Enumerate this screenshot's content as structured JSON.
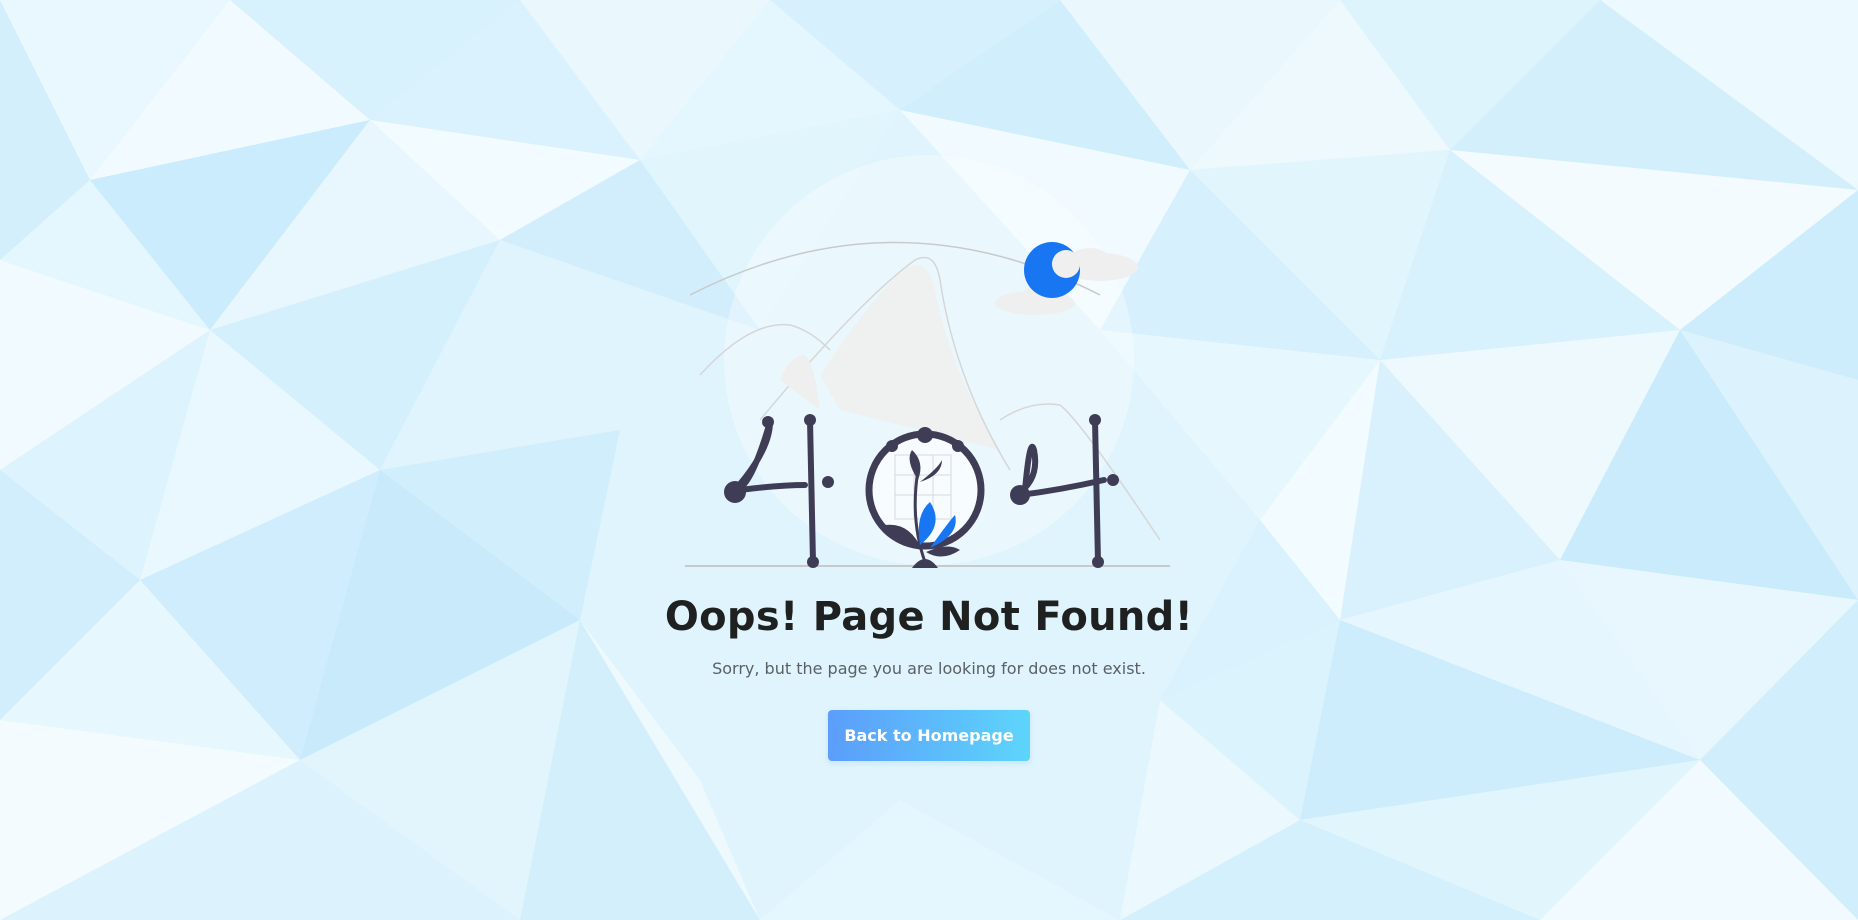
{
  "error": {
    "code_illustration": "404-illustration",
    "title": "Oops! Page Not Found!",
    "message": "Sorry, but the page you are looking for does not exist."
  },
  "actions": {
    "home_button_label": "Back to Homepage"
  },
  "colors": {
    "background": "#dff4fd",
    "accent_blue": "#1976f2",
    "digit_color": "#3f3d56",
    "button_gradient_start": "#5b9dfb",
    "button_gradient_end": "#5dd5fb",
    "title_color": "#1f2120"
  }
}
